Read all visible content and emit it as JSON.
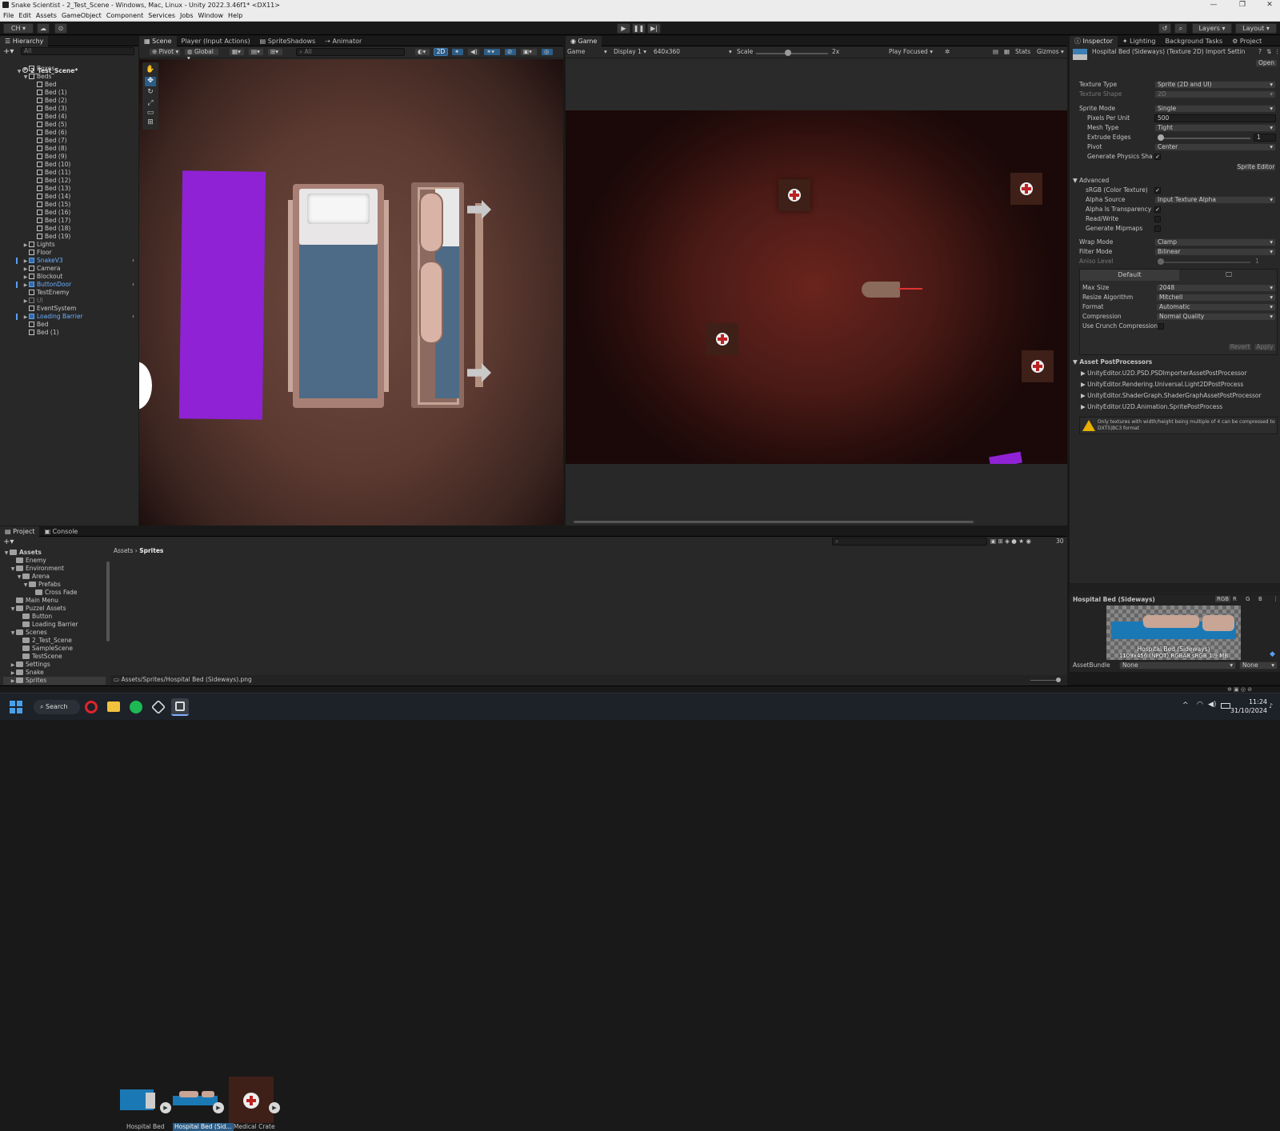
{
  "window": {
    "title": "Snake Scientist - 2_Test_Scene - Windows, Mac, Linux - Unity 2022.3.46f1* <DX11>",
    "minimize": "—",
    "maximize": "❐",
    "close": "✕"
  },
  "menu": [
    "File",
    "Edit",
    "Assets",
    "GameObject",
    "Component",
    "Services",
    "Jobs",
    "Window",
    "Help"
  ],
  "toolbar": {
    "account": "CH",
    "layers": "Layers",
    "layout": "Layout"
  },
  "hierarchy": {
    "tab": "Hierarchy",
    "search_placeholder": "All",
    "scene": "2_Test_Scene*",
    "items": [
      {
        "label": "Boxes",
        "depth": 1,
        "arrow": "▶",
        "type": "gray"
      },
      {
        "label": "Beds",
        "depth": 1,
        "arrow": "▼",
        "type": "gray"
      },
      {
        "label": "Bed",
        "depth": 2,
        "type": "gray"
      },
      {
        "label": "Bed (1)",
        "depth": 2,
        "type": "gray"
      },
      {
        "label": "Bed (2)",
        "depth": 2,
        "type": "gray"
      },
      {
        "label": "Bed (3)",
        "depth": 2,
        "type": "gray"
      },
      {
        "label": "Bed (4)",
        "depth": 2,
        "type": "gray"
      },
      {
        "label": "Bed (5)",
        "depth": 2,
        "type": "gray"
      },
      {
        "label": "Bed (6)",
        "depth": 2,
        "type": "gray"
      },
      {
        "label": "Bed (7)",
        "depth": 2,
        "type": "gray"
      },
      {
        "label": "Bed (8)",
        "depth": 2,
        "type": "gray"
      },
      {
        "label": "Bed (9)",
        "depth": 2,
        "type": "gray"
      },
      {
        "label": "Bed (10)",
        "depth": 2,
        "type": "gray"
      },
      {
        "label": "Bed (11)",
        "depth": 2,
        "type": "gray"
      },
      {
        "label": "Bed (12)",
        "depth": 2,
        "type": "gray"
      },
      {
        "label": "Bed (13)",
        "depth": 2,
        "type": "gray"
      },
      {
        "label": "Bed (14)",
        "depth": 2,
        "type": "gray"
      },
      {
        "label": "Bed (15)",
        "depth": 2,
        "type": "gray"
      },
      {
        "label": "Bed (16)",
        "depth": 2,
        "type": "gray"
      },
      {
        "label": "Bed (17)",
        "depth": 2,
        "type": "gray"
      },
      {
        "label": "Bed (18)",
        "depth": 2,
        "type": "gray"
      },
      {
        "label": "Bed (19)",
        "depth": 2,
        "type": "gray"
      },
      {
        "label": "Lights",
        "depth": 1,
        "arrow": "▶",
        "type": "gray"
      },
      {
        "label": "Floor",
        "depth": 1,
        "type": "gray"
      },
      {
        "label": "SnakeV3",
        "depth": 1,
        "arrow": "▶",
        "type": "blue",
        "more": true
      },
      {
        "label": "Camera",
        "depth": 1,
        "arrow": "▶",
        "type": "gray"
      },
      {
        "label": "Blockout",
        "depth": 1,
        "arrow": "▶",
        "type": "gray"
      },
      {
        "label": "ButtonDoor",
        "depth": 1,
        "arrow": "▶",
        "type": "blue",
        "more": true
      },
      {
        "label": "TestEnemy",
        "depth": 1,
        "type": "gray"
      },
      {
        "label": "UI",
        "depth": 1,
        "arrow": "▶",
        "type": "dim"
      },
      {
        "label": "EventSystem",
        "depth": 1,
        "type": "gray"
      },
      {
        "label": "Loading Barrier",
        "depth": 1,
        "arrow": "▶",
        "type": "blue",
        "more": true
      },
      {
        "label": "Bed",
        "depth": 1,
        "type": "gray"
      },
      {
        "label": "Bed (1)",
        "depth": 1,
        "type": "gray"
      }
    ]
  },
  "scene_tabs": [
    "Scene",
    "Player (Input Actions)",
    "SpriteShadows",
    "Animator"
  ],
  "scene_toolbar": {
    "pivot": "Pivot",
    "global": "Global",
    "search": "All",
    "mode2d": "2D"
  },
  "game": {
    "tab": "Game",
    "mode": "Game",
    "display": "Display 1",
    "resolution": "640x360",
    "scale_label": "Scale",
    "scale_value": "2x",
    "play_focused": "Play Focused",
    "stats": "Stats",
    "gizmos": "Gizmos"
  },
  "inspector": {
    "tabs": [
      "Inspector",
      "Lighting",
      "Background Tasks",
      "Project"
    ],
    "header": "Hospital Bed (Sideways) (Texture 2D) Import Settin",
    "open": "Open",
    "texture_type_label": "Texture Type",
    "texture_type": "Sprite (2D and UI)",
    "texture_shape_label": "Texture Shape",
    "texture_shape": "2D",
    "sprite_mode_label": "Sprite Mode",
    "sprite_mode": "Single",
    "ppu_label": "Pixels Per Unit",
    "ppu": "500",
    "mesh_type_label": "Mesh Type",
    "mesh_type": "Tight",
    "extrude_label": "Extrude Edges",
    "extrude": "1",
    "extrude_level": 1,
    "pivot_label": "Pivot",
    "pivot": "Center",
    "physics_label": "Generate Physics Shape",
    "sprite_editor": "Sprite Editor",
    "advanced": "Advanced",
    "srgb_label": "sRGB (Color Texture)",
    "alpha_source_label": "Alpha Source",
    "alpha_source": "Input Texture Alpha",
    "alpha_transp_label": "Alpha Is Transparency",
    "readwrite_label": "Read/Write",
    "mipmaps_label": "Generate Mipmaps",
    "wrap_label": "Wrap Mode",
    "wrap": "Clamp",
    "filter_label": "Filter Mode",
    "filter": "Bilinear",
    "aniso_label": "Aniso Level",
    "aniso": "1",
    "platform_default": "Default",
    "maxsize_label": "Max Size",
    "maxsize": "2048",
    "resize_label": "Resize Algorithm",
    "resize": "Mitchell",
    "format_label": "Format",
    "format": "Automatic",
    "compression_label": "Compression",
    "compression": "Normal Quality",
    "crunch_label": "Use Crunch Compression",
    "revert": "Revert",
    "apply": "Apply",
    "postproc_title": "Asset PostProcessors",
    "postprocessors": [
      "UnityEditor.U2D.PSD.PSDImporterAssetPostProcessor",
      "UnityEditor.Rendering.Universal.Light2DPostProcess",
      "UnityEditor.ShaderGraph.ShaderGraphAssetPostProcessor",
      "UnityEditor.U2D.Animation.SpritePostProcess"
    ],
    "warning": "Only textures with width/height being multiple of 4 can be compressed to DXT5|BC3 format",
    "preview_title": "Hospital Bed (Sideways)",
    "preview_channels": [
      "RGB",
      "R",
      "G",
      "B"
    ],
    "preview_name": "Hospital Bed (Sideways)",
    "preview_info": "1109x456 (NPOT)  RGBA8 sRGB  1.9 MB",
    "assetbundle_label": "AssetBundle",
    "assetbundle": "None",
    "assetbundle_variant": "None"
  },
  "project": {
    "tabs": [
      "Project",
      "Console"
    ],
    "breadcrumb_root": "Assets",
    "breadcrumb_leaf": "Sprites",
    "count": "30",
    "tree": [
      {
        "label": "Assets",
        "depth": 0,
        "arrow": "▼",
        "bold": true
      },
      {
        "label": "Enemy",
        "depth": 1
      },
      {
        "label": "Environment",
        "depth": 1,
        "arrow": "▼"
      },
      {
        "label": "Arena",
        "depth": 2,
        "arrow": "▼"
      },
      {
        "label": "Prefabs",
        "depth": 3,
        "arrow": "▼"
      },
      {
        "label": "Cross Fade",
        "depth": 4
      },
      {
        "label": "Main Menu",
        "depth": 1
      },
      {
        "label": "Puzzel Assets",
        "depth": 1,
        "arrow": "▼"
      },
      {
        "label": "Button",
        "depth": 2
      },
      {
        "label": "Loading Barrier",
        "depth": 2
      },
      {
        "label": "Scenes",
        "depth": 1,
        "arrow": "▼"
      },
      {
        "label": "2_Test_Scene",
        "depth": 2
      },
      {
        "label": "SampleScene",
        "depth": 2
      },
      {
        "label": "TestScene",
        "depth": 2
      },
      {
        "label": "Settings",
        "depth": 1,
        "arrow": "▶"
      },
      {
        "label": "Snake",
        "depth": 1,
        "arrow": "▶"
      },
      {
        "label": "Sprites",
        "depth": 1,
        "arrow": "▶"
      }
    ],
    "assets": [
      "Hospital Bed",
      "Hospital Bed (Sid...",
      "Medical Crate"
    ],
    "path": "Assets/Sprites/Hospital Bed (Sideways).png"
  },
  "taskbar": {
    "search": "Search",
    "time": "11:24",
    "date": "31/10/2024"
  },
  "colors": {
    "accent": "#2c5d87",
    "purple": "#8f22d4",
    "bed_blue": "#4d6b86",
    "selection": "#2c5d87"
  }
}
